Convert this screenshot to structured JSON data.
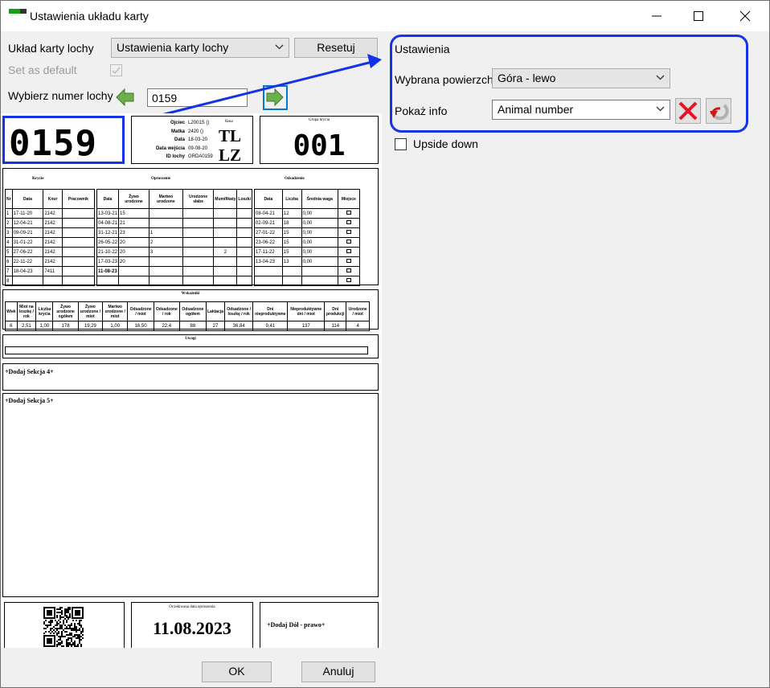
{
  "window": {
    "title": "Ustawienia układu karty"
  },
  "left": {
    "layout_label": "Układ karty lochy",
    "layout_value": "Ustawienia karty lochy",
    "reset_button": "Resetuj",
    "default_label": "Set as default",
    "sow_label": "Wybierz numer lochy",
    "sow_number": "0159"
  },
  "settings": {
    "title": "Ustawienia",
    "surface_label": "Wybrana powierzchn",
    "surface_value": "Góra - lewo",
    "info_label": "Pokaż info",
    "info_value": "Animal number",
    "upside_down": "Upside down"
  },
  "card": {
    "big_number": "0159",
    "info_rows": [
      {
        "label": "Ojciec",
        "value": "L2001S ()"
      },
      {
        "label": "Matka",
        "value": "2420 ()"
      },
      {
        "label": "Data",
        "value": "18-03-20"
      },
      {
        "label": "Data wejścia",
        "value": "09-08-20"
      },
      {
        "label": "ID lochy",
        "value": "GRDA0159"
      }
    ],
    "rasa_label": "Rasa",
    "breed_1": "TL",
    "breed_2": "LZ",
    "group_title": "Grupa krycia",
    "group_value": "001",
    "sections": {
      "krycie": "Krycie",
      "oproszenie": "Oproszenie",
      "odsadzenie": "Odsadzenie",
      "wskazniki": "Wskaźniki",
      "uwagi": "Uwagi"
    },
    "krycie_headers": [
      "Data",
      "Knur",
      "Pracownik"
    ],
    "oprosz_headers": [
      "Data",
      "Żywo urodzone",
      "Martwo urodzone",
      "Urodzone słabe",
      "Mumifikaty",
      "Loszki"
    ],
    "odsad_headers": [
      "Data",
      "Liczba",
      "Średnia waga",
      "Miejsce"
    ],
    "row_no_header": "Nr",
    "rows": [
      {
        "n": "1",
        "kd": "17-11-20",
        "kk": "2142",
        "od": "13-03-21",
        "ozy": "15",
        "omu": "",
        "dd": "08-04-21",
        "dl": "12",
        "dw": "0,00"
      },
      {
        "n": "2",
        "kd": "12-04-21",
        "kk": "2142",
        "od": "04-08-21",
        "ozy": "21",
        "omu": "",
        "dd": "02-09-21",
        "dl": "18",
        "dw": "0,00"
      },
      {
        "n": "3",
        "kd": "09-09-21",
        "kk": "2142",
        "od": "31-12-21",
        "ozy": "23",
        "omu": "1",
        "dd": "27-01-22",
        "dl": "15",
        "dw": "0,00"
      },
      {
        "n": "4",
        "kd": "31-01-22",
        "kk": "2142",
        "od": "26-05-22",
        "ozy": "20",
        "omu": "2",
        "dd": "23-06-22",
        "dl": "15",
        "dw": "0,00"
      },
      {
        "n": "5",
        "kd": "27-06-22",
        "kk": "2142",
        "od": "21-10-22",
        "ozy": "20",
        "omu": "3",
        "dd": "17-11-22",
        "dl": "15",
        "dw": "0,00"
      },
      {
        "n": "6",
        "kd": "22-11-22",
        "kk": "2142",
        "od": "17-03-23",
        "ozy": "20",
        "omu": "",
        "dd": "13-04-23",
        "dl": "13",
        "dw": "0,00"
      },
      {
        "n": "7",
        "kd": "18-04-23",
        "kk": "7411",
        "od": "11-08-23",
        "ozy": "",
        "omu": "",
        "dd": "",
        "dl": "",
        "dw": ""
      },
      {
        "n": "8",
        "kd": "",
        "kk": "",
        "od": "",
        "ozy": "",
        "omu": "",
        "dd": "",
        "dl": "",
        "dw": ""
      }
    ],
    "extra_mark": "2",
    "stat_headers": [
      "Wiek",
      "Miot na loszkę / rok",
      "Liczba krycia",
      "Żywo urodzone ogółem",
      "Żywo urodzone / miot",
      "Martwo urodzone / miot",
      "Odsadzone / miot",
      "Odsadzone / rok",
      "Odsadzone ogółem",
      "Laktacja",
      "Odsadzone / loszkę / rok",
      "Dni nieproduktywne",
      "Nieproduktywne dni / miot",
      "Dni produkcji",
      "Urodzone / miot"
    ],
    "stat_values": [
      "6",
      "2,51",
      "1,00",
      "178",
      "19,29",
      "1,00",
      "16,50",
      "22,4",
      "88",
      "27",
      "36,84",
      "9,41",
      "137",
      "114",
      "4"
    ],
    "add_section_4": "+Dodaj Sekcja 4+",
    "add_section_5": "+Dodaj Sekcja 5+",
    "farrow_title": "Oczekiwana data oproszenia",
    "farrow_date": "11.08.2023",
    "bottom_right": "+Dodaj Dół - prawo+"
  },
  "footer": {
    "ok": "OK",
    "cancel": "Anuluj"
  },
  "colors": {
    "highlight": "#1432e6",
    "green_arrow": "#6ab04c",
    "delete_red": "#e81123"
  }
}
